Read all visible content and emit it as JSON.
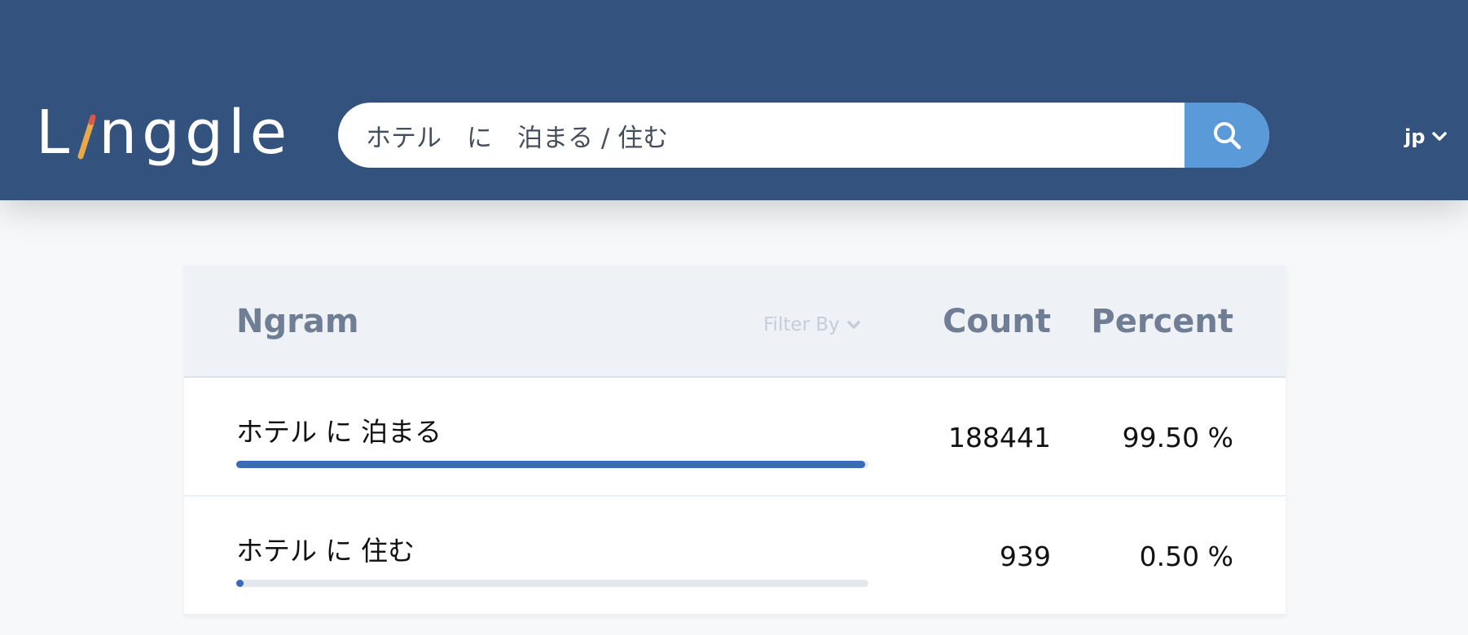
{
  "header": {
    "logo_text": "Linggle",
    "search": {
      "value": "ホテル　に　泊まる / 住む",
      "placeholder": ""
    },
    "language": "jp",
    "colors": {
      "header_bg": "#33527e",
      "search_button": "#5b9ad8",
      "pencil": "#e8a94b"
    }
  },
  "table": {
    "headers": {
      "ngram": "Ngram",
      "filter": "Filter By",
      "count": "Count",
      "percent": "Percent"
    },
    "rows": [
      {
        "ngram": "ホテル に 泊まる",
        "count": "188441",
        "percent": "99.50 %",
        "ratio": 0.995
      },
      {
        "ngram": "ホテル に 住む",
        "count": "939",
        "percent": "0.50 %",
        "ratio": 0.005
      }
    ]
  }
}
